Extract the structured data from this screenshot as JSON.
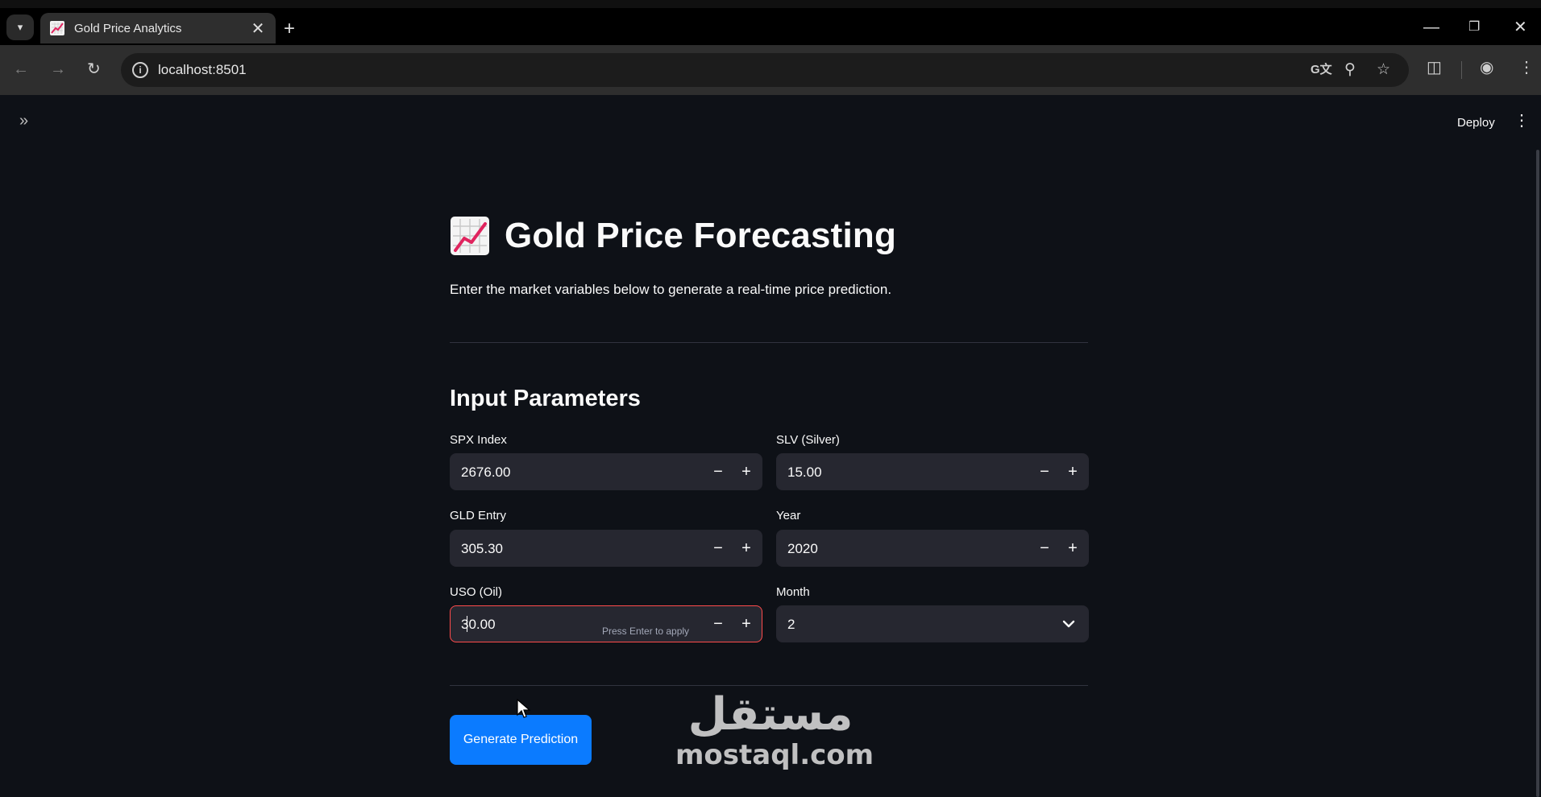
{
  "browser": {
    "tab_title": "Gold Price Analytics",
    "url": "localhost:8501"
  },
  "app": {
    "deploy_label": "Deploy",
    "title": "Gold Price Forecasting",
    "subtitle": "Enter the market variables below to generate a real-time price prediction.",
    "section_title": "Input Parameters",
    "fields": {
      "spx": {
        "label": "SPX Index",
        "value": "2676.00"
      },
      "slv": {
        "label": "SLV (Silver)",
        "value": "15.00"
      },
      "gld": {
        "label": "GLD Entry",
        "value": "305.30"
      },
      "year": {
        "label": "Year",
        "value": "2020"
      },
      "uso": {
        "label": "USO (Oil)",
        "value": "30.00",
        "hint": "Press Enter to apply"
      },
      "month": {
        "label": "Month",
        "value": "2"
      }
    },
    "button_label": "Generate Prediction"
  },
  "watermark": {
    "arabic": "مستقل",
    "latin": "mostaql.com"
  },
  "icons": {
    "favicon": "chart-increasing-icon",
    "accent": "#0b7bff",
    "focus_border": "#ff4b4b"
  }
}
